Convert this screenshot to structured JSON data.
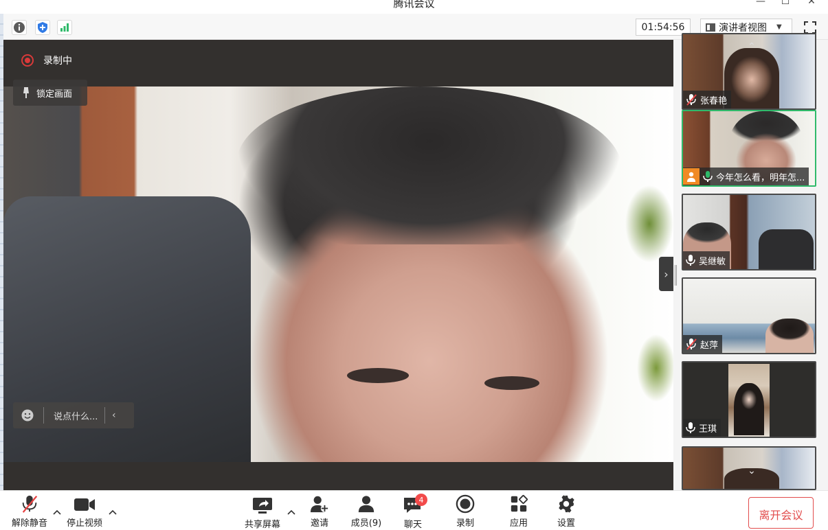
{
  "window": {
    "title": "腾讯会议",
    "minimize": "—",
    "maximize": "☐",
    "close": "✕"
  },
  "toolbar": {
    "timer": "01:54:56",
    "view_mode": "演讲者视图"
  },
  "recording": {
    "label": "录制中"
  },
  "main_video": {
    "lock_label": "锁定画面",
    "chat_placeholder": "说点什么..."
  },
  "participants": [
    {
      "name": "张春艳",
      "mic": "muted"
    },
    {
      "name": "今年怎么看，明年怎...",
      "mic": "speaking",
      "active": true
    },
    {
      "name": "吴继敏",
      "mic": "on"
    },
    {
      "name": "赵萍",
      "mic": "muted"
    },
    {
      "name": "王琪",
      "mic": "on"
    },
    {
      "name": "",
      "mic": "none"
    }
  ],
  "bottom_toolbar": {
    "unmute": "解除静音",
    "stop_video": "停止视频",
    "share_screen": "共享屏幕",
    "invite": "邀请",
    "members": "成员(9)",
    "chat": "聊天",
    "chat_badge": "4",
    "record": "录制",
    "apps": "应用",
    "settings": "设置",
    "leave": "离开会议"
  },
  "colors": {
    "accent_green": "#2fba6a",
    "record_red": "#d93a3a",
    "leave_red": "#e24b4b",
    "badge_red": "#f24b4b",
    "orange_avatar": "#f08a24"
  }
}
